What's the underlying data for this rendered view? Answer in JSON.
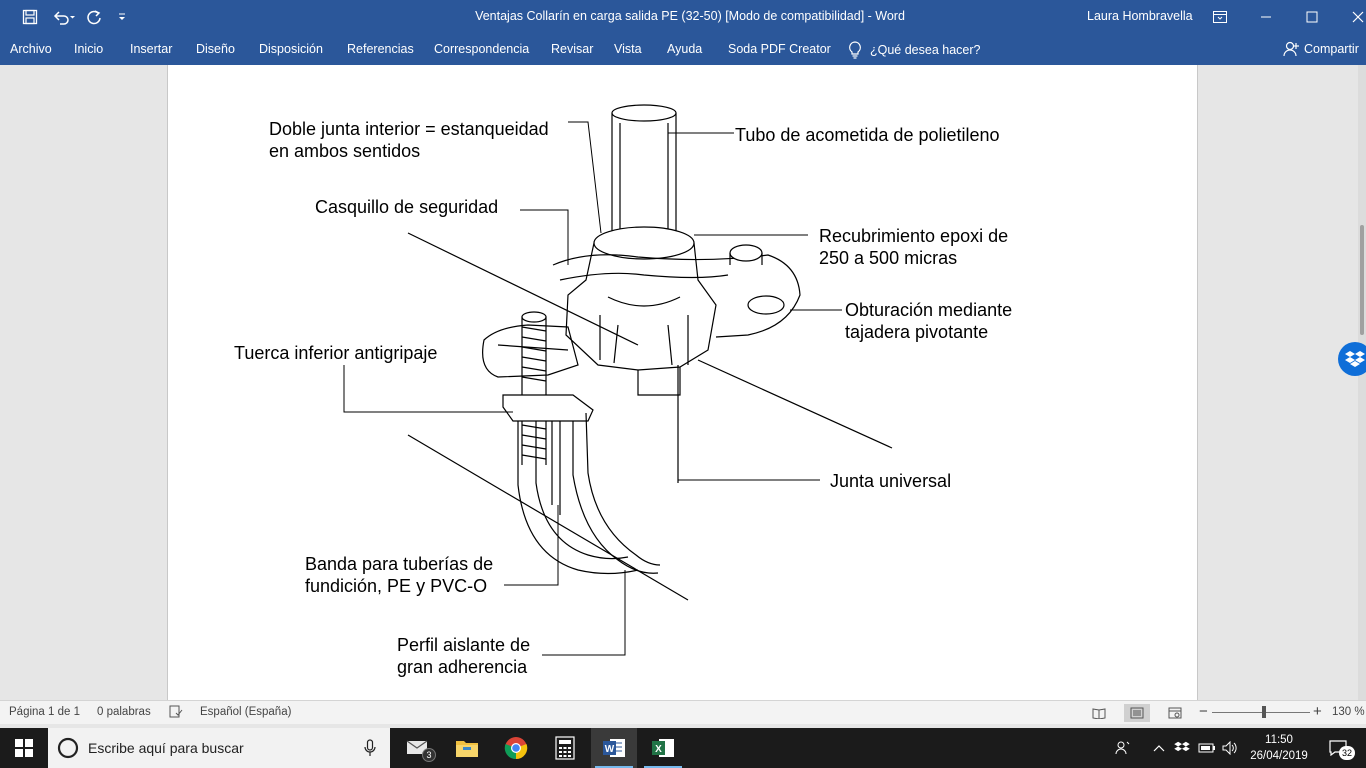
{
  "titlebar": {
    "title": "Ventajas Collarín en carga salida PE (32-50) [Modo de compatibilidad]  -  Word",
    "user": "Laura Hombravella",
    "colors": {
      "bg": "#2b579a",
      "text": "#ffffff"
    }
  },
  "ribbon": {
    "tabs": [
      "Archivo",
      "Inicio",
      "Insertar",
      "Diseño",
      "Disposición",
      "Referencias",
      "Correspondencia",
      "Revisar",
      "Vista",
      "Ayuda",
      "Soda PDF Creator"
    ],
    "tell_me": "¿Qué desea hacer?",
    "share": "Compartir"
  },
  "diagram": {
    "labels": {
      "doble_junta_1": "Doble junta interior = estanqueidad",
      "doble_junta_2": "en ambos sentidos",
      "tubo": "Tubo de acometida de polietileno",
      "casquillo": "Casquillo de seguridad",
      "recubrimiento_1": "Recubrimiento epoxi de",
      "recubrimiento_2": "250 a 500 micras",
      "obturacion_1": "Obturación mediante",
      "obturacion_2": "tajadera pivotante",
      "tuerca": "Tuerca inferior antigripaje",
      "junta_universal": "Junta universal",
      "banda_1": "Banda para tuberías de",
      "banda_2": "fundición, PE y PVC-O",
      "perfil_1": "Perfil aislante de",
      "perfil_2": "gran adherencia"
    }
  },
  "statusbar": {
    "page": "Página 1 de 1",
    "words": "0 palabras",
    "language": "Español (España)",
    "zoom": "130 %",
    "zoom_level_percent": 130
  },
  "taskbar": {
    "search_placeholder": "Escribe aquí para buscar",
    "mail_badge": "3",
    "time": "11:50",
    "date": "26/04/2019",
    "notifications": "32"
  }
}
